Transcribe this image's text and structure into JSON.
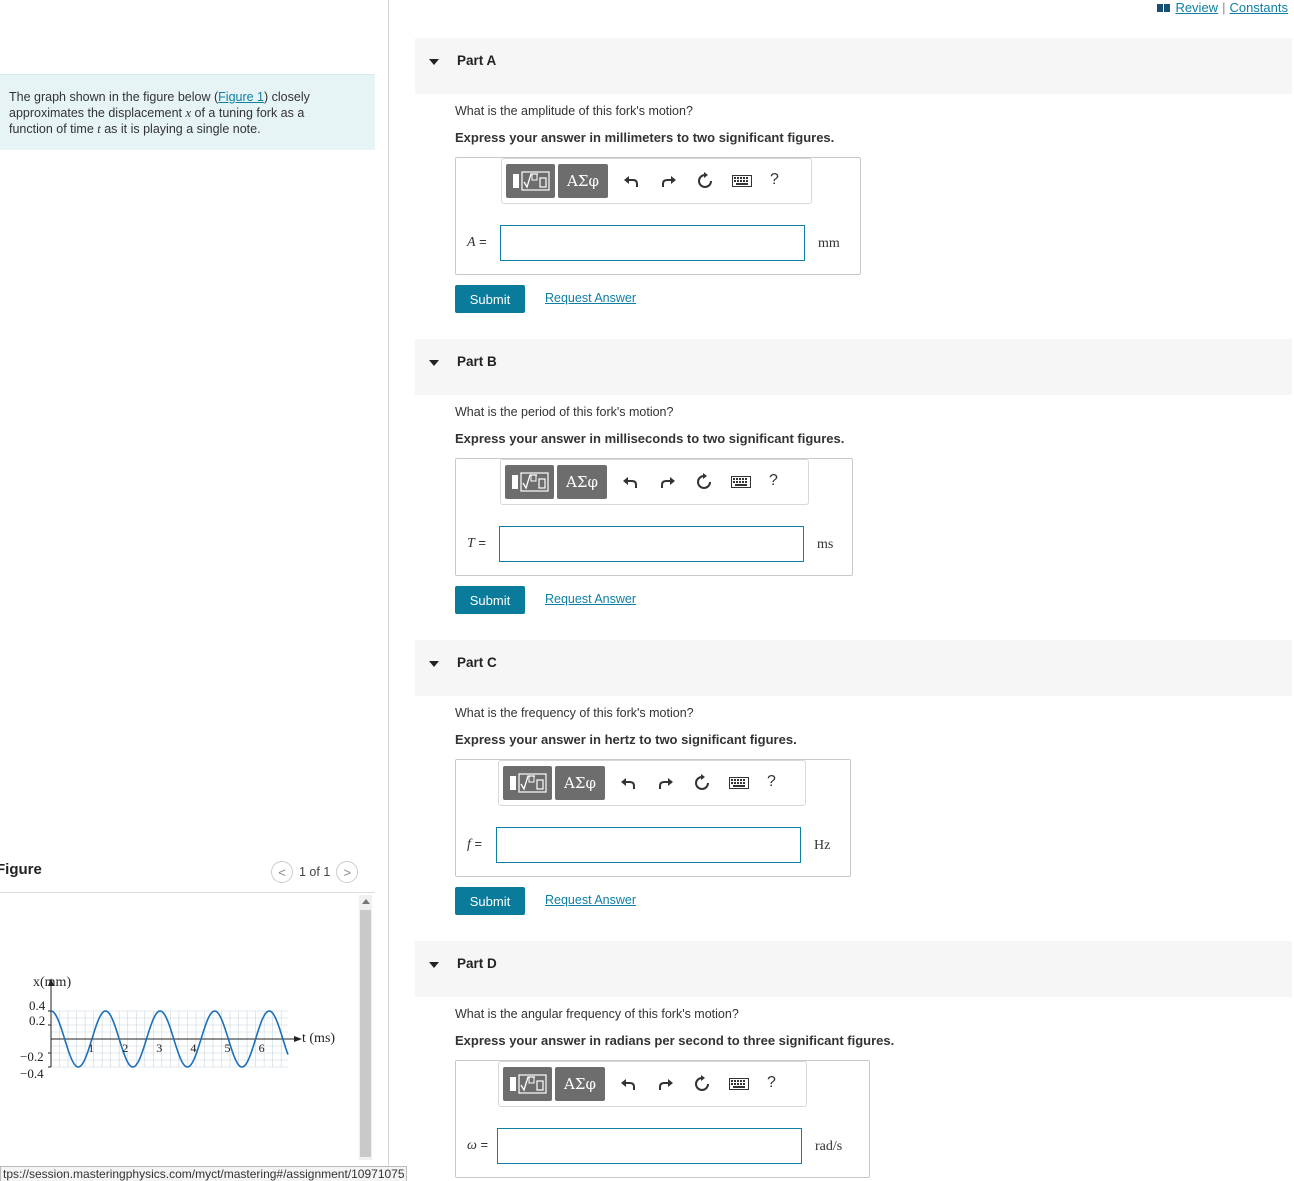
{
  "top_links": {
    "review": "Review",
    "separator": "|",
    "constants": "Constants"
  },
  "intro": {
    "before_link": "The graph shown in the figure below (",
    "link": "Figure 1",
    "after_link": ") closely approximates the displacement ",
    "var_x": "x",
    "mid": " of a tuning fork as a function of time ",
    "var_t": "t",
    "end": " as it is playing a single note."
  },
  "figure": {
    "label": "Figure",
    "pager": "1 of 1",
    "prev_glyph": "<",
    "next_glyph": ">"
  },
  "graph": {
    "y_axis_label": "x(mm)",
    "x_axis_label": "t (ms)",
    "y_ticks": [
      "0.4",
      "0.2",
      "−0.2",
      "−0.4"
    ],
    "x_ticks": [
      "1",
      "2",
      "3",
      "4",
      "5",
      "6"
    ]
  },
  "chart_data": {
    "type": "line",
    "xlabel": "t (ms)",
    "ylabel": "x(mm)",
    "xlim": [
      0,
      7
    ],
    "ylim": [
      -0.4,
      0.4
    ],
    "x_tick_values": [
      1,
      2,
      3,
      4,
      5,
      6
    ],
    "y_tick_values": [
      -0.4,
      -0.2,
      0.2,
      0.4
    ],
    "amplitude": 0.4,
    "period": 1.6,
    "grid": true
  },
  "status_url": "tps://session.masteringphysics.com/myct/mastering#/assignment/10971075",
  "toolbar": {
    "greek": "ΑΣφ",
    "help": "?"
  },
  "parts": [
    {
      "title": "Part A",
      "question": "What is the amplitude of this fork's motion?",
      "instruction": "Express your answer in millimeters to two significant figures.",
      "var": "A",
      "eq": " =",
      "unit": "mm",
      "value": "",
      "submit": "Submit",
      "request": "Request Answer"
    },
    {
      "title": "Part B",
      "question": "What is the period of this fork's motion?",
      "instruction": "Express your answer in milliseconds to two significant figures.",
      "var": "T",
      "eq": " =",
      "unit": "ms",
      "value": "",
      "submit": "Submit",
      "request": "Request Answer"
    },
    {
      "title": "Part C",
      "question": "What is the frequency of this fork's motion?",
      "instruction": "Express your answer in hertz to two significant figures.",
      "var": "f",
      "eq": " =",
      "unit": "Hz",
      "value": "",
      "submit": "Submit",
      "request": "Request Answer"
    },
    {
      "title": "Part D",
      "question": "What is the angular frequency of this fork's motion?",
      "instruction": "Express your answer in radians per second to three significant figures.",
      "var": "ω",
      "eq": " =",
      "unit": "rad/s",
      "value": ""
    }
  ]
}
